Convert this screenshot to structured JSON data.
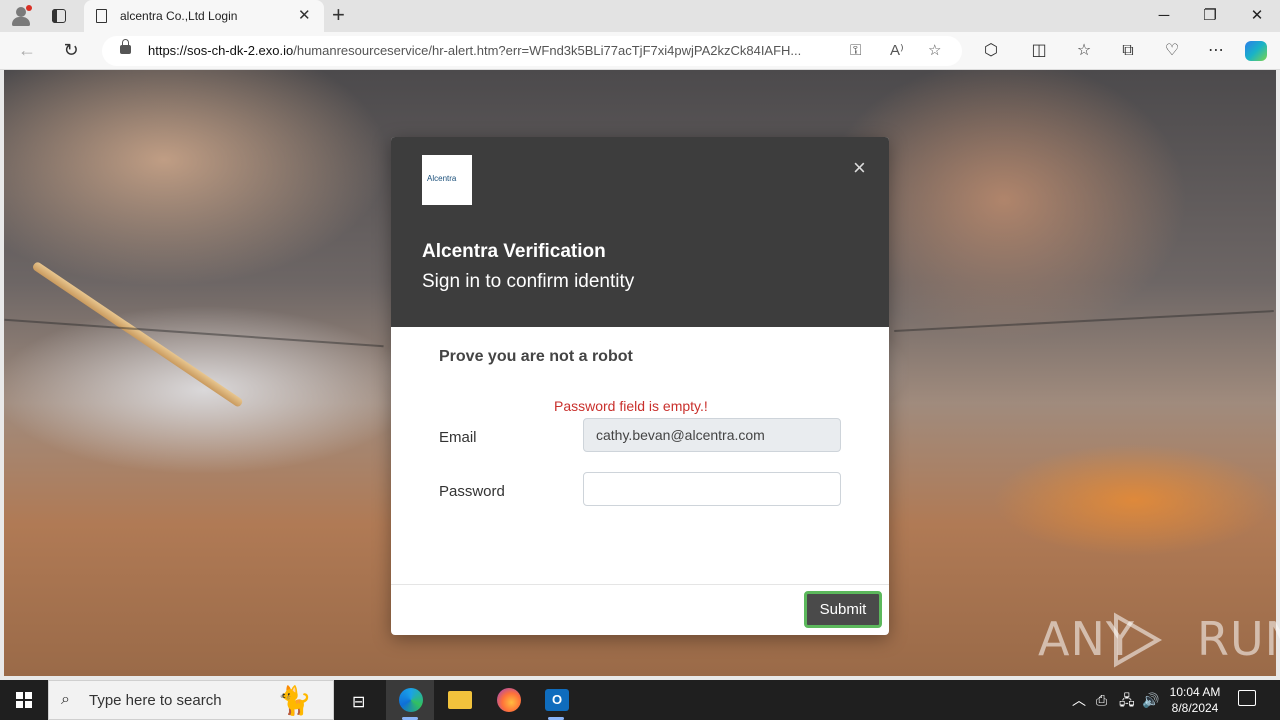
{
  "browser": {
    "tab_title": "alcentra Co.,Ltd Login",
    "new_tab": "+",
    "url_host": "https://sos-ch-dk-2.exo.io",
    "url_path": "/humanresourceservice/hr-alert.htm?err=WFnd3k5BLi77acTjF7xi4pwjPA2kzCk84IAFH...",
    "window_controls": {
      "minimize": "─",
      "restore": "❐",
      "close": "✕"
    }
  },
  "modal": {
    "logo_text": "Alcentra",
    "close_glyph": "×",
    "title": "Alcentra Verification",
    "subtitle": "Sign in to confirm identity",
    "heading": "Prove you are not a robot",
    "error": "Password field is empty.!",
    "email_label": "Email",
    "email_value": "cathy.bevan@alcentra.com",
    "password_label": "Password",
    "password_value": "",
    "submit_label": "Submit",
    "accent_color": "#5cb85c"
  },
  "watermark": {
    "text_left": "ANY",
    "text_right": "RUN"
  },
  "taskbar": {
    "search_placeholder": "Type here to search",
    "time": "10:04 AM",
    "date": "8/8/2024",
    "apps": [
      "task-view-icon",
      "edge-icon",
      "file-explorer-icon",
      "firefox-icon",
      "outlook-icon"
    ]
  }
}
